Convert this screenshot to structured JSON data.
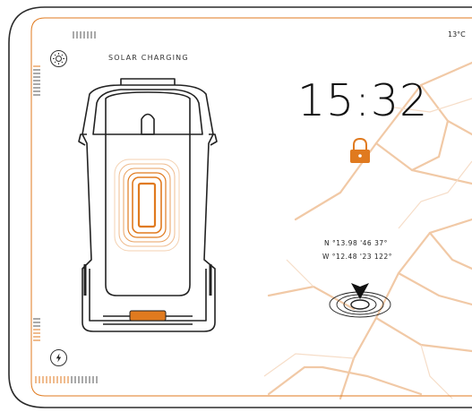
{
  "header": {
    "title": "SOLAR CHARGING",
    "temperature": "13°C"
  },
  "clock": {
    "time": "15:32"
  },
  "location": {
    "north": "N  °13.98  '46  37°",
    "west": "W  °12.48  '23  122°"
  },
  "icons": {
    "brightness": "sun-icon",
    "charge": "lightning-icon",
    "lock": "lock-icon",
    "marker": "location-arrow-icon"
  },
  "colors": {
    "accent": "#E07A1F",
    "map_roads": "#F1C9A6",
    "frame": "#2b2b2b"
  }
}
